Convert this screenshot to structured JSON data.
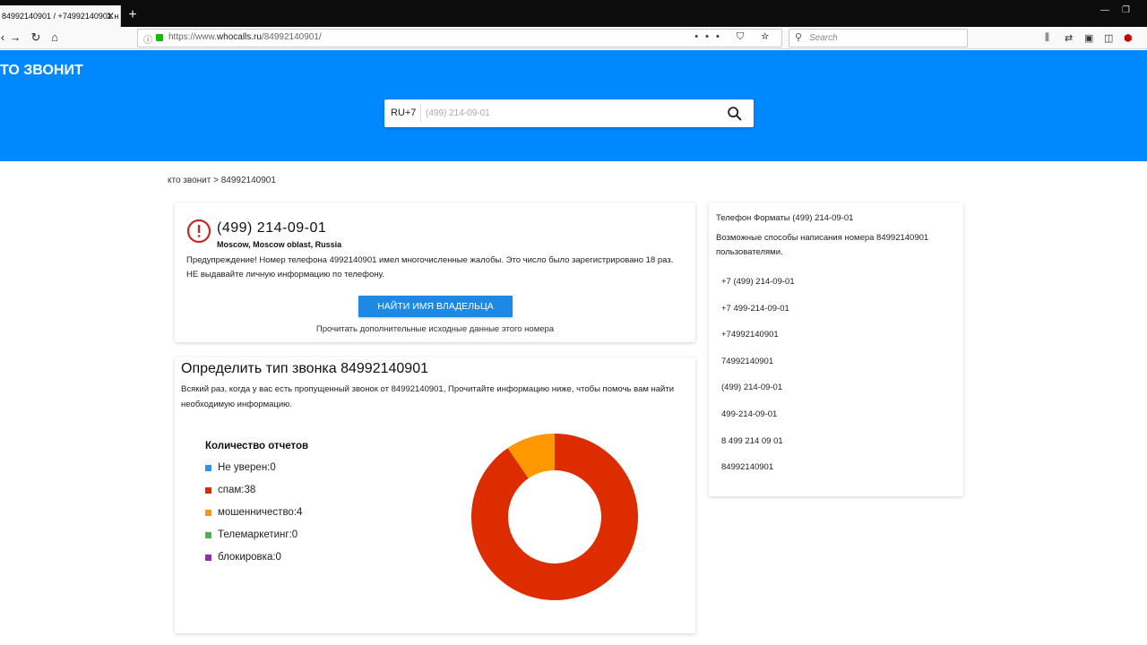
{
  "browser": {
    "tab_title": "84992140901 / +74992140901 н",
    "tab_close": "✕",
    "new_tab": "+",
    "url_prefix": "https://www.",
    "url_domain": "whocalls.ru",
    "url_path": "/84992140901/",
    "search_placeholder": "Search",
    "page_actions": "•••",
    "win_minimize": "—",
    "win_restore": "❐"
  },
  "site": {
    "logo": "ТО ЗВОНИТ",
    "country_prefix": "RU+7",
    "search_placeholder": "(499) 214-09-01"
  },
  "breadcrumb": "кто звонит > 84992140901",
  "warning_card": {
    "phone": "(499) 214-09-01",
    "location": "Moscow, Moscow oblast, Russia",
    "text": "Предупреждение! Номер телефона 4992140901 имел многочисленные жалобы. Это число было зарегистрировано 18 раз. НЕ выдавайте личную информацию по телефону.",
    "button": "НАЙТИ ИМЯ ВЛАДЕЛЬЦА",
    "more": "Прочитать дополнительные исходные данные этого номера"
  },
  "call_type": {
    "title": "Определить тип звонка 84992140901",
    "description": "Всякий раз, когда у вас есть пропущенный звонок от 84992140901, Прочитайте информацию ниже, чтобы помочь вам найти необходимую информацию.",
    "legend_title": "Количество отчетов",
    "items": [
      {
        "label": "Не уверен:0",
        "name": "Не уверен",
        "value": 0,
        "color": "#2196f3"
      },
      {
        "label": "спам:38",
        "name": "спам",
        "value": 38,
        "color": "#dd2c00"
      },
      {
        "label": "мошенничество:4",
        "name": "мошенничество",
        "value": 4,
        "color": "#ff9800"
      },
      {
        "label": "Телемаркетинг:0",
        "name": "Телемаркетинг",
        "value": 0,
        "color": "#4caf50"
      },
      {
        "label": "блокировка:0",
        "name": "блокировка",
        "value": 0,
        "color": "#9c27b0"
      }
    ]
  },
  "chart_data": {
    "type": "pie",
    "title": "Количество отчетов",
    "categories": [
      "Не уверен",
      "спам",
      "мошенничество",
      "Телемаркетинг",
      "блокировка"
    ],
    "values": [
      0,
      38,
      4,
      0,
      0
    ],
    "colors": [
      "#2196f3",
      "#dd2c00",
      "#ff9800",
      "#4caf50",
      "#9c27b0"
    ],
    "donut": true,
    "legend": "left"
  },
  "formats": {
    "title": "Телефон Форматы (499) 214-09-01",
    "description": "Возможные способы написания номера 84992140901 пользователями.",
    "items": [
      "+7 (499) 214-09-01",
      "+7 499-214-09-01",
      "+74992140901",
      "74992140901",
      "(499) 214-09-01",
      "499-214-09-01",
      "8 499 214 09 01",
      "84992140901"
    ]
  },
  "colors": {
    "header_blue": "#0089ff",
    "button_blue": "#1e88e5",
    "warning_red": "#c62828"
  }
}
